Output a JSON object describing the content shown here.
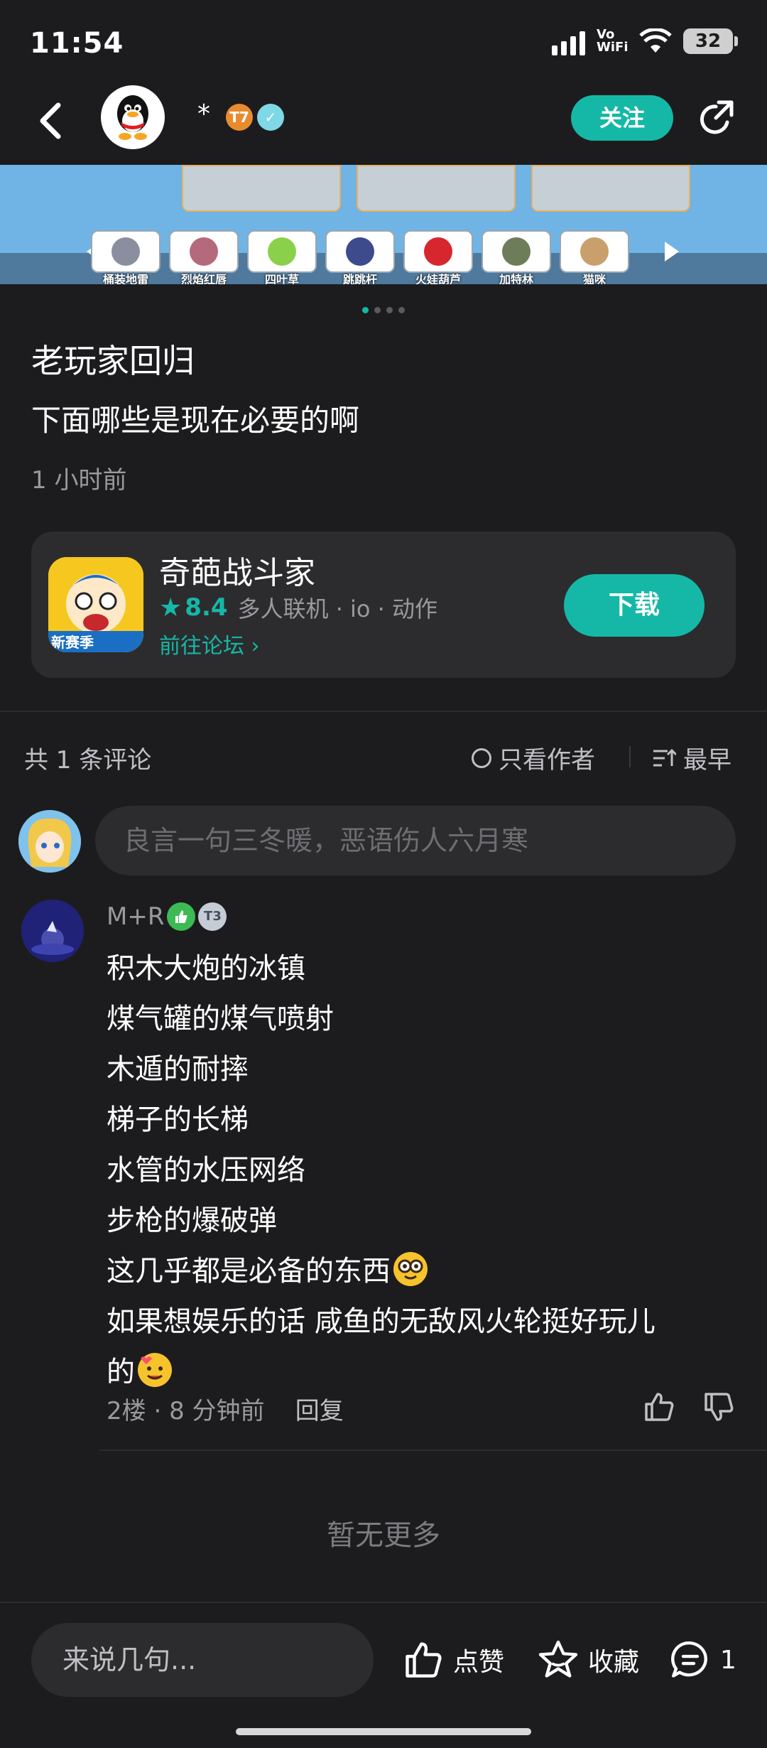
{
  "status": {
    "time": "11:54",
    "network": "Vo WiFi",
    "battery": "32"
  },
  "header": {
    "author": "*",
    "level_badge": "T7",
    "follow_label": "关注"
  },
  "banner": {
    "items": [
      "桶装地雷",
      "烈焰红唇",
      "四叶草",
      "跳跳杆",
      "火娃葫芦",
      "加特林",
      "猫咪"
    ],
    "active_page": 1,
    "page_count": 4
  },
  "post": {
    "title": "老玩家回归",
    "body": "下面哪些是现在必要的啊",
    "time": "1 小时前"
  },
  "game": {
    "name": "奇葩战斗家",
    "rating": "8.4",
    "tags": "多人联机 · io · 动作",
    "forum_link": "前往论坛",
    "download_label": "下载",
    "icon_badge": "新赛季"
  },
  "comments_header": {
    "count": "共 1 条评论",
    "only_author": "只看作者",
    "sort": "最早"
  },
  "comment_input": {
    "placeholder": "良言一句三冬暖，恶语伤人六月寒"
  },
  "comment": {
    "user": "M+R",
    "badge": "T3",
    "lines": [
      "积木大炮的冰镇",
      "煤气罐的煤气喷射",
      "木遁的耐摔",
      "梯子的长梯",
      "水管的水压网络",
      "步枪的爆破弹",
      "这几乎都是必备的东西",
      "如果想娱乐的话 咸鱼的无敌风火轮挺好玩儿",
      "的"
    ],
    "floor": "2楼",
    "time": "8 分钟前",
    "reply_label": "回复"
  },
  "footer": {
    "no_more": "暂无更多",
    "say_placeholder": "来说几句...",
    "like_label": "点赞",
    "fav_label": "收藏",
    "comment_count": "1"
  },
  "colors": {
    "accent": "#15b8a6",
    "background": "#1c1c1e",
    "card": "#2c2c2e"
  }
}
